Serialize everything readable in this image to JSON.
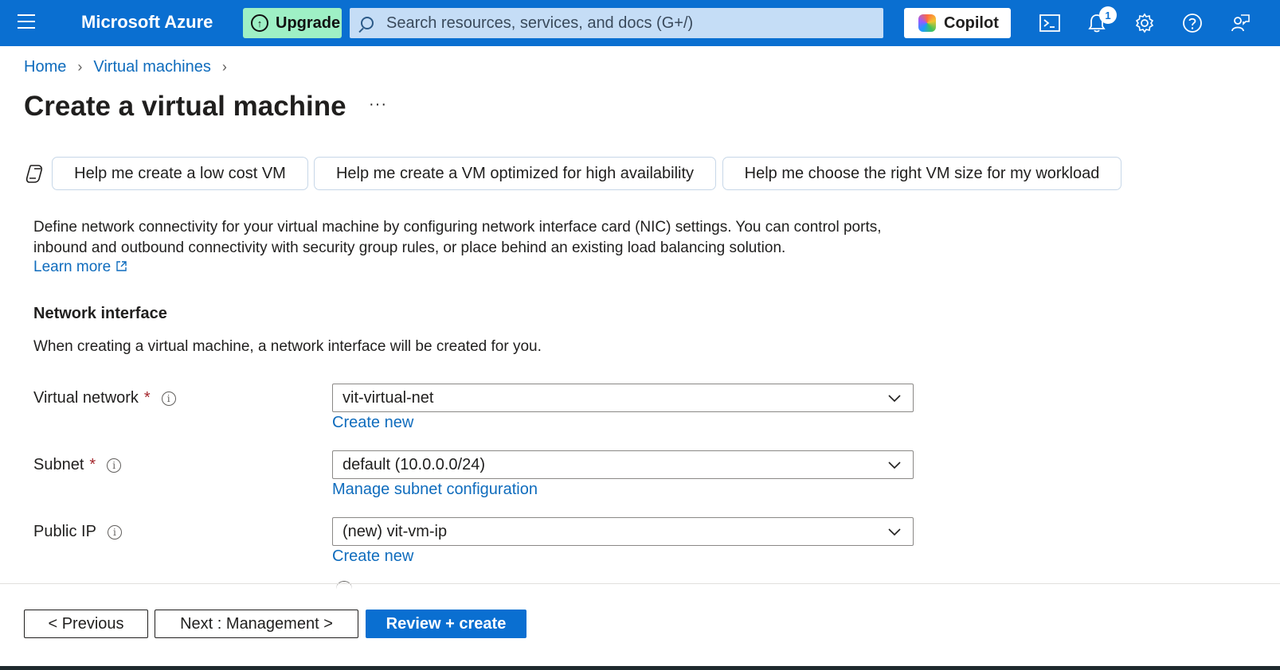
{
  "topbar": {
    "brand": "Microsoft Azure",
    "upgrade_label": "Upgrade",
    "search_placeholder": "Search resources, services, and docs (G+/)",
    "copilot_label": "Copilot",
    "notification_count": "1"
  },
  "breadcrumb": {
    "items": [
      "Home",
      "Virtual machines"
    ]
  },
  "page": {
    "title": "Create a virtual machine",
    "more": "···"
  },
  "prompts": [
    "Help me create a low cost VM",
    "Help me create a VM optimized for high availability",
    "Help me choose the right VM size for my workload"
  ],
  "intro": {
    "description": "Define network connectivity for your virtual machine by configuring network interface card (NIC) settings. You can control ports, inbound and outbound connectivity with security group rules, or place behind an existing load balancing solution.",
    "learn_more": "Learn more"
  },
  "network_interface": {
    "title": "Network interface",
    "description": "When creating a virtual machine, a network interface will be created for you.",
    "fields": [
      {
        "label": "Virtual network",
        "required": true,
        "value": "vit-virtual-net",
        "link": "Create new"
      },
      {
        "label": "Subnet",
        "required": true,
        "value": "default (10.0.0.0/24)",
        "link": "Manage subnet configuration"
      },
      {
        "label": "Public IP",
        "required": false,
        "value": "(new) vit-vm-ip",
        "link": "Create new"
      }
    ]
  },
  "footer": {
    "previous": "< Previous",
    "next": "Next : Management >",
    "review": "Review + create"
  },
  "colors": {
    "azure_blue": "#0a6fd1",
    "upgrade_green": "#9ef0c5",
    "link": "#0f6cbd",
    "required": "#a4262c"
  }
}
